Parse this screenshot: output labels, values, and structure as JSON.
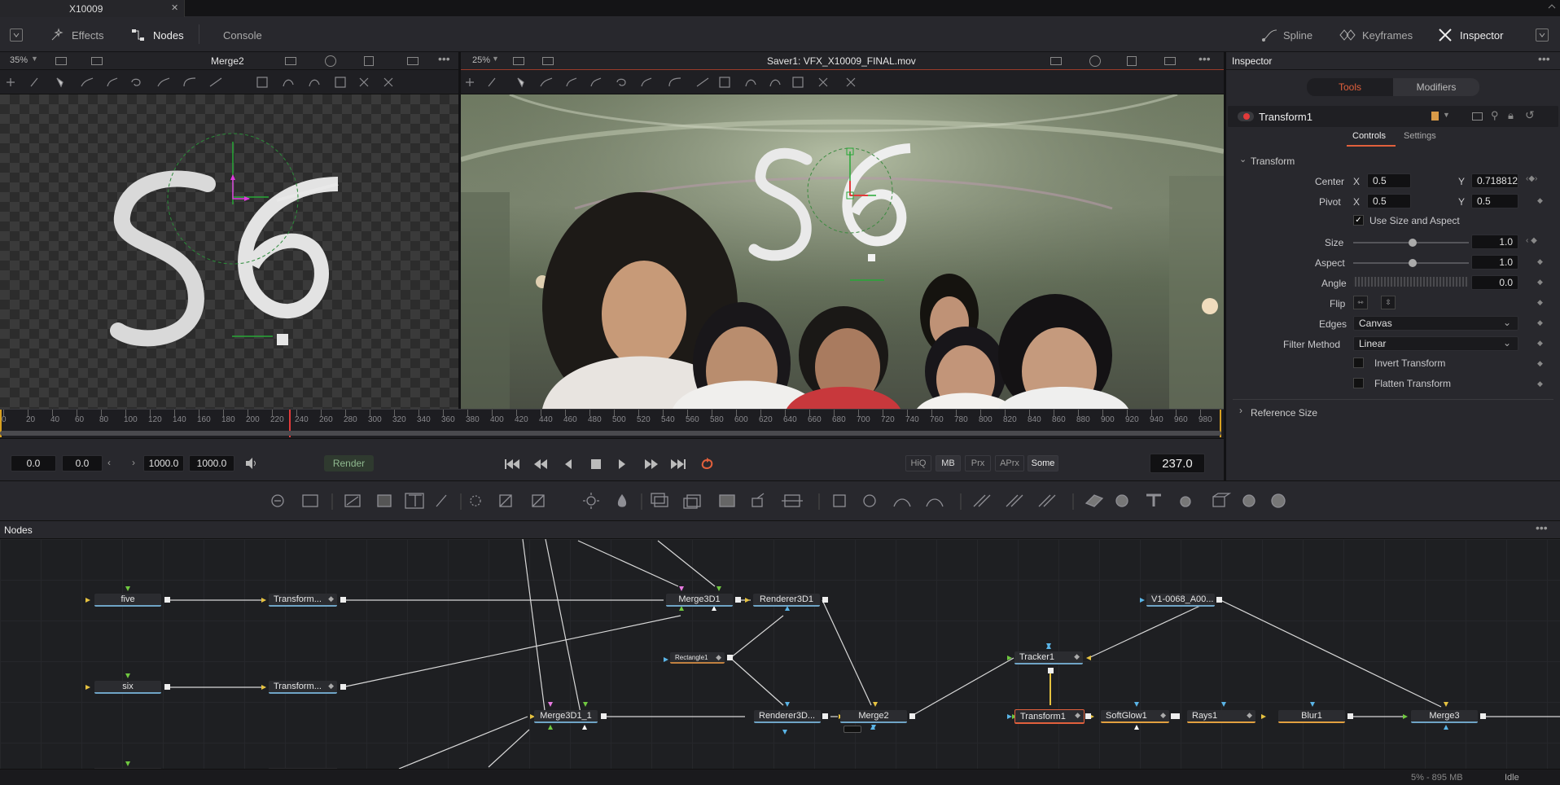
{
  "tab": {
    "title": "X10009",
    "close": "✕"
  },
  "topbar": {
    "effects": "Effects",
    "nodes": "Nodes",
    "console": "Console",
    "spline": "Spline",
    "keyframes": "Keyframes",
    "inspector": "Inspector"
  },
  "viewer_left": {
    "zoom": "35%",
    "title": "Merge2"
  },
  "viewer_right": {
    "zoom": "25%",
    "title": "Saver1: VFX_X10009_FINAL.mov"
  },
  "timeline": {
    "ticks": [
      "0",
      "20",
      "40",
      "60",
      "80",
      "100",
      "120",
      "140",
      "160",
      "180",
      "200",
      "220",
      "240",
      "260",
      "280",
      "300",
      "320",
      "340",
      "360",
      "380",
      "400",
      "420",
      "440",
      "460",
      "480",
      "500",
      "520",
      "540",
      "560",
      "580",
      "600",
      "620",
      "640",
      "660",
      "680",
      "700",
      "720",
      "740",
      "760",
      "780",
      "800",
      "820",
      "840",
      "860",
      "880",
      "900",
      "920",
      "940",
      "960",
      "980"
    ],
    "current_frame_readout": 237
  },
  "transport": {
    "start": "0.0",
    "in": "0.0",
    "out": "1000.0",
    "end": "1000.0",
    "render": "Render",
    "hiq": "HiQ",
    "mb": "MB",
    "prx": "Prx",
    "aprx": "APrx",
    "some": "Some",
    "frame": "237.0"
  },
  "inspector": {
    "title": "Inspector",
    "tabs": {
      "tools": "Tools",
      "modifiers": "Modifiers"
    },
    "tool_name": "Transform1",
    "subtabs": {
      "controls": "Controls",
      "settings": "Settings"
    },
    "section": "Transform",
    "center_label": "Center",
    "center_x": "0.5",
    "center_y": "0.718812",
    "pivot_label": "Pivot",
    "pivot_x": "0.5",
    "pivot_y": "0.5",
    "x": "X",
    "y": "Y",
    "use_size_aspect": "Use Size and Aspect",
    "size_label": "Size",
    "size_val": "1.0",
    "aspect_label": "Aspect",
    "aspect_val": "1.0",
    "angle_label": "Angle",
    "angle_val": "0.0",
    "flip_label": "Flip",
    "edges_label": "Edges",
    "edges_val": "Canvas",
    "filter_label": "Filter Method",
    "filter_val": "Linear",
    "invert": "Invert Transform",
    "flatten": "Flatten Transform",
    "reference_size": "Reference Size"
  },
  "nodes_panel": {
    "title": "Nodes",
    "nodes": {
      "five": "five",
      "six": "six",
      "t1": "Transform...",
      "t2": "Transform...",
      "merge3d1": "Merge3D1",
      "renderer3d1": "Renderer3D1",
      "rectangle1": "Rectangle1",
      "merge3d1_1": "Merge3D1_1",
      "renderer3d2": "Renderer3D...",
      "merge2": "Merge2",
      "tracker1": "Tracker1",
      "transform1": "Transform1",
      "softglow1": "SoftGlow1",
      "rays1": "Rays1",
      "blur1": "Blur1",
      "merge3": "Merge3",
      "v1": "V1-0068_A00..."
    }
  },
  "status": {
    "usage": "5% - 895 MB",
    "state": "Idle"
  },
  "colors": {
    "accent": "#e2603c",
    "bg": "#1c1c20",
    "panel": "#28282d",
    "link": "#6fa4c6"
  }
}
